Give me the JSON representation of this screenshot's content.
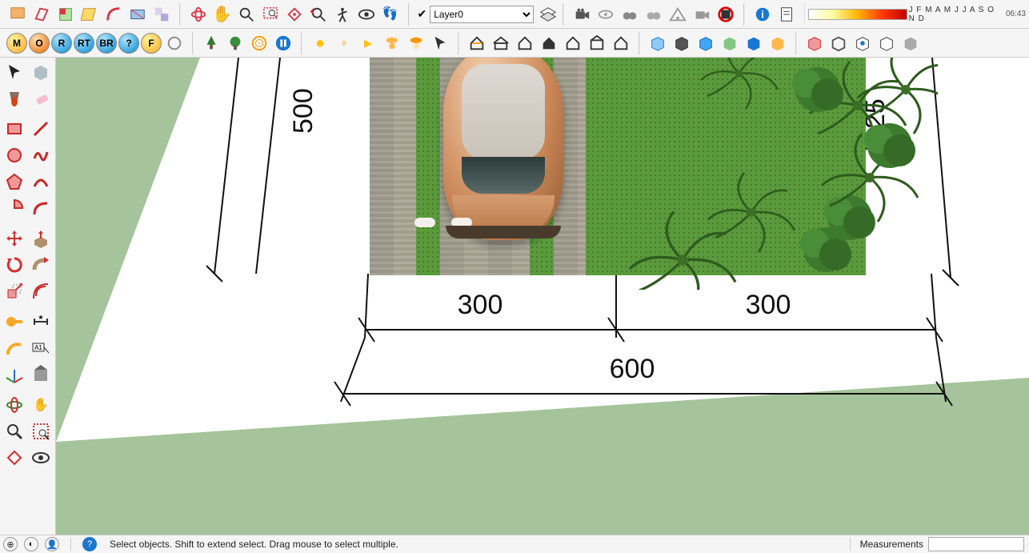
{
  "layer": {
    "selected": "Layer0",
    "options": [
      "Layer0"
    ]
  },
  "months": "J F M A M J J A S O N D",
  "time": "06:43",
  "render_buttons": [
    "M",
    "O",
    "R",
    "RT",
    "BR",
    "?",
    "F"
  ],
  "status": {
    "hint": "Select objects. Shift to extend select. Drag mouse to select multiple.",
    "measurements_label": "Measurements",
    "measurements_value": ""
  },
  "dimensions": {
    "left_vertical": "500",
    "right_vertical": "425",
    "bottom_left": "300",
    "bottom_right": "300",
    "bottom_total": "600"
  },
  "tooltips": {
    "select": "Select",
    "eraser": "Eraser",
    "line": "Line",
    "rect": "Rectangle",
    "circle": "Circle",
    "freehand": "Freehand",
    "arc": "Arc",
    "arc2": "2-Point Arc",
    "pushpull": "Push/Pull",
    "followme": "Follow Me",
    "move": "Move",
    "rotate": "Rotate",
    "scale": "Scale",
    "offset": "Offset",
    "tape": "Tape Measure",
    "dim": "Dimension",
    "protractor": "Protractor",
    "text": "Text",
    "axes": "Axes",
    "orbit": "Orbit",
    "pan": "Pan",
    "zoom": "Zoom",
    "zoomwin": "Zoom Window",
    "zoomext": "Zoom Extents",
    "eye": "Look Around"
  }
}
